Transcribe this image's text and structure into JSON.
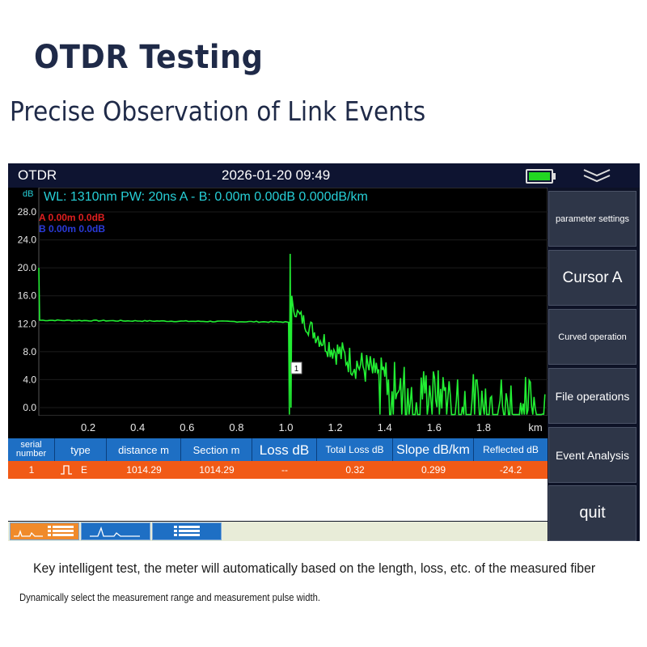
{
  "page": {
    "title": "OTDR Testing",
    "subtitle": "Precise Observation of Link Events",
    "caption_line1": "Key intelligent test, the meter will automatically based on the length, loss, etc. of the measured fiber",
    "caption_line2": "Dynamically select the measurement range and measurement pulse width."
  },
  "status_bar": {
    "app_name": "OTDR",
    "datetime": "2026-01-20 09:49",
    "icons": [
      "battery-icon",
      "chevron-menu-icon"
    ],
    "battery_color": "#22d622"
  },
  "plot": {
    "info_line": "WL: 1310nm  PW: 20ns  A - B:  0.00m 0.00dB 0.000dB/km",
    "y_unit": "dB",
    "x_unit": "km",
    "y_ticks": [
      "28.0",
      "24.0",
      "20.0",
      "16.0",
      "12.0",
      "8.0",
      "4.0",
      "0.0"
    ],
    "x_ticks": [
      "0.2",
      "0.4",
      "0.6",
      "0.8",
      "1.0",
      "1.2",
      "1.4",
      "1.6",
      "1.8"
    ],
    "cursor_a": "A 0.00m 0.0dB",
    "cursor_b": "B 0.00m 0.0dB",
    "event_marker": "1",
    "trace_color": "#22ee33",
    "cursor_a_color": "#e01f1f",
    "cursor_b_color": "#2a3ad8",
    "info_color": "#27d0d8"
  },
  "sidebar": {
    "buttons": [
      {
        "label": "parameter settings"
      },
      {
        "label": "Cursor A"
      },
      {
        "label": "Curved operation"
      },
      {
        "label": "File operations"
      },
      {
        "label": "Event Analysis"
      },
      {
        "label": "quit"
      }
    ]
  },
  "event_table": {
    "header_color": "#1e6fc4",
    "row_color": "#f15a16",
    "columns": [
      "serial number",
      "type",
      "distance m",
      "Section m",
      "Loss dB",
      "Total Loss dB",
      "Slope dB/km",
      "Reflected dB"
    ],
    "rows": [
      {
        "serial": "1",
        "type_icon": "pulse-icon",
        "type": "E",
        "distance": "1014.29",
        "section": "1014.29",
        "loss": "--",
        "total_loss": "0.32",
        "slope": "0.299",
        "reflected": "-24.2"
      }
    ]
  },
  "tabs": [
    {
      "name": "trace-and-table-tab",
      "icons": [
        "trace-icon",
        "list-icon"
      ],
      "active": true
    },
    {
      "name": "trace-tab",
      "icons": [
        "trace-icon"
      ],
      "active": false
    },
    {
      "name": "table-tab",
      "icons": [
        "list-icon"
      ],
      "active": false
    }
  ]
}
